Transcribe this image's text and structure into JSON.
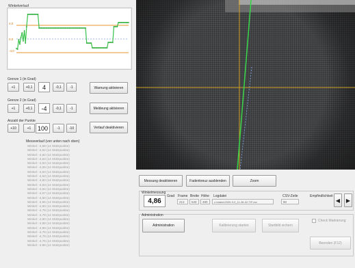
{
  "graph": {
    "title": "Winkelverlauf",
    "upper_label": "4,0",
    "zero_label": "0,0",
    "lower_label": "-4,0"
  },
  "chart_data": {
    "type": "line",
    "title": "Winkelverlauf",
    "ylim": [
      -8,
      8
    ],
    "limits": {
      "upper": 4,
      "lower": -4
    },
    "x": [
      1,
      2,
      3,
      4,
      5,
      6,
      7,
      8,
      9,
      10,
      11,
      12,
      13,
      14,
      15,
      16,
      17,
      18,
      19,
      20,
      21,
      22,
      23,
      24,
      25,
      26,
      27,
      28,
      29,
      30,
      31,
      32,
      33,
      34,
      35,
      36,
      37,
      38,
      39,
      40,
      41,
      42,
      43,
      44,
      45,
      46,
      47,
      48,
      49,
      50,
      51,
      52,
      53,
      54,
      55,
      56,
      57,
      58,
      59,
      60,
      61,
      62,
      63,
      64,
      65,
      66,
      67,
      68,
      69,
      70,
      71,
      72,
      73,
      74,
      75,
      76,
      77,
      78,
      79,
      80,
      81,
      82,
      83,
      84,
      85,
      86,
      87,
      88,
      89,
      90,
      91,
      92,
      93,
      94,
      95,
      96,
      97,
      98,
      99,
      100
    ],
    "series": [
      {
        "values": [
          -2.8,
          -3.0,
          -0.2,
          -1.5,
          0.5,
          1.8,
          -0.6,
          2.4,
          -1.2,
          3.6,
          7.2,
          7.2,
          7.2,
          7.2,
          7.2,
          7.2,
          7.2,
          7.2,
          7.2,
          7.2,
          3.2,
          3.2,
          3.2,
          3.2,
          3.2,
          3.2,
          3.2,
          3.2,
          3.2,
          3.2,
          3.2,
          3.2,
          3.2,
          3.2,
          3.2,
          3.2,
          3.2,
          3.2,
          3.2,
          3.2,
          3.2,
          3.2,
          3.2,
          3.2,
          3.2,
          3.2,
          3.2,
          3.2,
          3.2,
          3.2,
          3.2,
          3.2,
          3.2,
          3.2,
          3.2,
          3.2,
          3.2,
          3.2,
          3.2,
          3.2,
          3.2,
          3.2,
          -1.2,
          -1.2,
          -1.2,
          -1.2,
          -1.2,
          -2.6,
          -2.6,
          -2.6,
          -2.6,
          -2.6,
          -2.6,
          -2.6,
          -2.6,
          -2.6,
          -2.6,
          -2.6,
          -2.6,
          -2.6,
          -2.6,
          -1.0,
          -1.0,
          -1.0,
          -1.0,
          -1.0,
          3.6,
          3.6,
          3.6,
          3.6,
          4.8,
          4.8,
          4.8,
          4.8,
          4.8,
          4.8,
          4.8,
          4.8,
          4.8,
          4.8
        ]
      }
    ]
  },
  "grenze1": {
    "label": "Grenze 1 (in Grad)",
    "plus1": "+1",
    "plus01": "+0,1",
    "value": "4",
    "minus01": "-0,1",
    "minus1": "-1",
    "action": "Warnung aktivieren"
  },
  "grenze2": {
    "label": "Grenze 2 (in Grad)",
    "plus1": "+1",
    "plus01": "+0,1",
    "value": "-4",
    "minus01": "-0,1",
    "minus1": "-1",
    "action": "Meldeung aktivieren"
  },
  "punkte": {
    "label": "Anzahl der Punkte",
    "plus10": "+10",
    "plus1": "+1",
    "value": "100",
    "minus1": "-1",
    "minus10": "-10",
    "action": "Verlauf deaktivieren"
  },
  "log": {
    "title": "Messverlauf (von unten nach oben)",
    "entries": [
      "Winkel: -4,58 (14 Stützpunkte)",
      "Winkel: -4,62 (14 Stützpunkte)",
      "Winkel: -4,62 (14 Stützpunkte)",
      "Winkel: -4,63 (14 Stützpunkte)",
      "Winkel: -4,63 (14 Stützpunkte)",
      "Winkel: -4,58 (14 Stützpunkte)",
      "Winkel: -4,63 (14 Stützpunkte)",
      "Winkel: -4,63 (14 Stützpunkte)",
      "Winkel: -4,60 (14 Stützpunkte)",
      "Winkel: -4,63 (14 Stützpunkte)",
      "Winkel: -4,64 (14 Stützpunkte)",
      "Winkel: -4,57 (14 Stützpunkte)",
      "Winkel: -4,60 (14 Stützpunkte)",
      "Winkel: -4,56 (14 Stützpunkte)",
      "Winkel: -4,60 (14 Stützpunkte)",
      "Winkel: -4,78 (14 Stützpunkte)",
      "Winkel: -4,78 (14 Stützpunkte)",
      "Winkel: -4,90 (14 Stützpunkte)",
      "Winkel: -4,88 (14 Stützpunkte)",
      "Winkel: -4,88 (14 Stützpunkte)",
      "Winkel: -4,76 (14 Stützpunkte)",
      "Winkel: -4,78 (14 Stützpunkte)",
      "Winkel: -4,76 (14 Stützpunkte)",
      "Winkel: -4,86 (14 Stützpunkte)"
    ]
  },
  "camera_buttons": {
    "messung": "Messung deaktivieren",
    "fadenkreuz": "Fadenkreuz ausblenden",
    "zoom": "Zoom"
  },
  "measurement": {
    "group_label": "Winkelmessung",
    "value": "4,86",
    "grad_label": "Grad",
    "frame_label": "Frame",
    "frame_value": "213",
    "breite_label": "Breite",
    "breite_value": "640",
    "hoehe_label": "Höhe",
    "hoehe_value": "480",
    "logdatei_label": "Logdatei",
    "logdatei_value": "c:\\daten\\2009-9-9_11-36-32.TIF.csv",
    "csv_label": "CSV-Zeile",
    "csv_value": "80",
    "empf_label": "Empfindlichkeit"
  },
  "admin": {
    "group_label": "Administration",
    "admin_button": "Administration",
    "kalibrierung": "Kalibrierung starten",
    "startbild": "Startbild sichern",
    "checkbox_label": "Check Markierung",
    "beenden": "Beenden (F12)"
  }
}
